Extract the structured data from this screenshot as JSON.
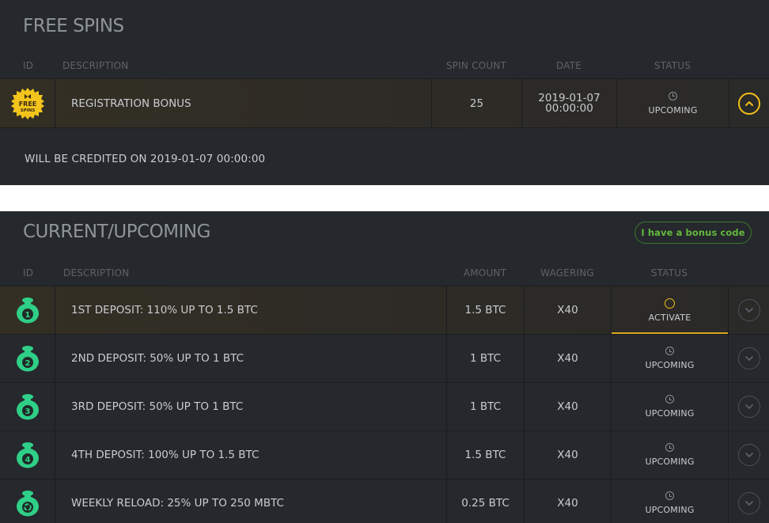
{
  "free_spins": {
    "title": "FREE SPINS",
    "headers": {
      "id": "ID",
      "description": "DESCRIPTION",
      "spin_count": "SPIN COUNT",
      "date": "DATE",
      "status": "STATUS"
    },
    "row": {
      "badge_line1": "FREE",
      "badge_line2": "SPINS",
      "description": "REGISTRATION BONUS",
      "spin_count": "25",
      "date_line1": "2019-01-07",
      "date_line2": "00:00:00",
      "status": "UPCOMING",
      "status_icon": "clock-icon",
      "expanded": true
    },
    "credit_note": "WILL BE CREDITED ON 2019-01-07 00:00:00"
  },
  "current_upcoming": {
    "title": "CURRENT/UPCOMING",
    "bonus_code_button": "I have a bonus code",
    "headers": {
      "id": "ID",
      "description": "DESCRIPTION",
      "amount": "AMOUNT",
      "wagering": "WAGERING",
      "status": "STATUS"
    },
    "rows": [
      {
        "num": "1",
        "description": "1ST DEPOSIT: 110% UP TO 1.5 BTC",
        "amount": "1.5 BTC",
        "wagering": "X40",
        "status": "ACTIVATE",
        "icon": "money-bag-icon"
      },
      {
        "num": "2",
        "description": "2ND DEPOSIT: 50% UP TO 1 BTC",
        "amount": "1 BTC",
        "wagering": "X40",
        "status": "UPCOMING",
        "icon": "money-bag-icon"
      },
      {
        "num": "3",
        "description": "3RD DEPOSIT: 50% UP TO 1 BTC",
        "amount": "1 BTC",
        "wagering": "X40",
        "status": "UPCOMING",
        "icon": "money-bag-icon"
      },
      {
        "num": "4",
        "description": "4TH DEPOSIT: 100% UP TO 1.5 BTC",
        "amount": "1.5 BTC",
        "wagering": "X40",
        "status": "UPCOMING",
        "icon": "money-bag-icon"
      },
      {
        "num": "",
        "description": "WEEKLY RELOAD: 25% UP TO 250 MBTC",
        "amount": "0.25 BTC",
        "wagering": "X40",
        "status": "UPCOMING",
        "icon": "reload-bag-icon"
      }
    ]
  },
  "colors": {
    "panel": "#25282c",
    "accent_yellow": "#f1be1a",
    "bag_green": "#2fcf87",
    "button_green": "#63b83d"
  }
}
